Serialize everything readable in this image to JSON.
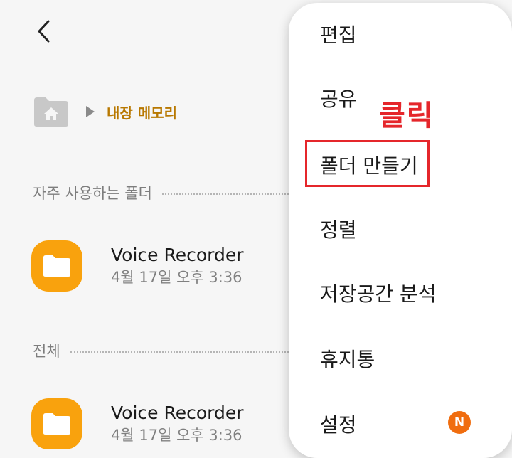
{
  "header": {
    "back_icon": "chevron-left-icon"
  },
  "breadcrumb": {
    "home_icon": "home-folder-icon",
    "arrow_icon": "caret-right-icon",
    "location": "내장 메모리"
  },
  "sections": {
    "frequent": {
      "title": "자주 사용하는 폴더",
      "items": [
        {
          "name": "Voice Recorder",
          "date": "4월 17일 오후 3:36",
          "icon": "folder-icon"
        }
      ]
    },
    "all": {
      "title": "전체",
      "items": [
        {
          "name": "Voice Recorder",
          "date": "4월 17일 오후 3:36",
          "icon": "folder-icon"
        }
      ]
    }
  },
  "menu": {
    "items": [
      {
        "label": "편집"
      },
      {
        "label": "공유"
      },
      {
        "label": "폴더 만들기"
      },
      {
        "label": "정렬"
      },
      {
        "label": "저장공간 분석"
      },
      {
        "label": "휴지통"
      },
      {
        "label": "설정"
      }
    ],
    "settings_badge": "N"
  },
  "annotation": {
    "text": "클릭",
    "color": "#e5262b"
  },
  "colors": {
    "accent": "#b87800",
    "folder": "#f9a20d",
    "badge": "#f06d0f"
  }
}
